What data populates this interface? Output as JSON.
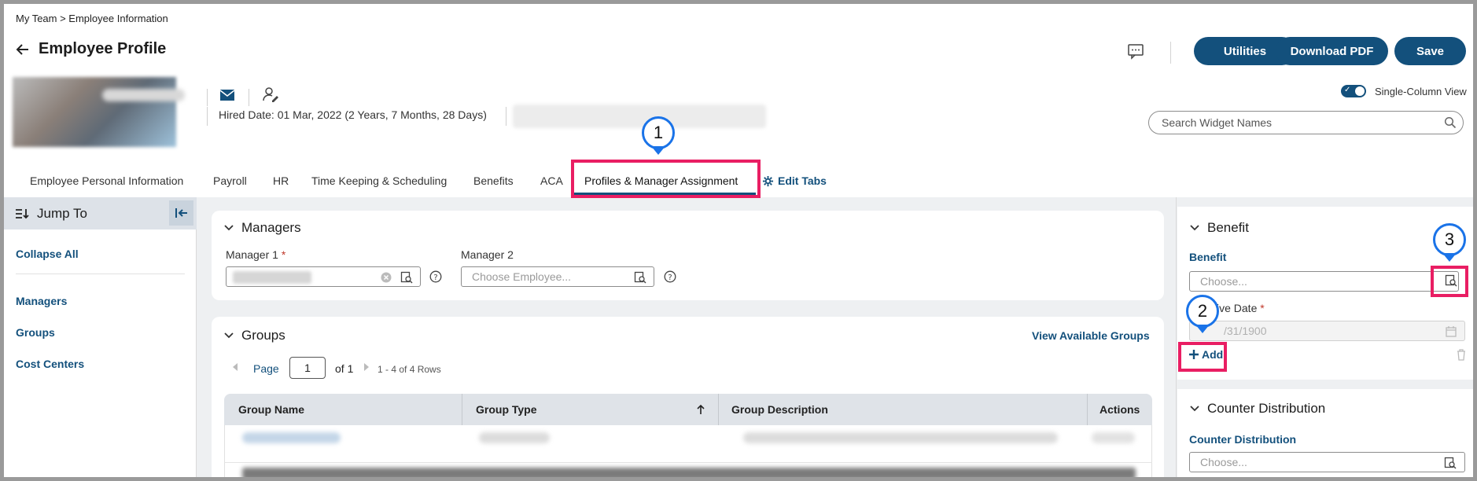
{
  "breadcrumb": "My Team  >  Employee Information",
  "page_title": "Employee Profile",
  "buttons": {
    "utilities": "Utilities",
    "download_pdf": "Download PDF",
    "save": "Save"
  },
  "employee": {
    "hired_label": "Hired Date:",
    "hired_value": "01 Mar, 2022 (2 Years, 7 Months, 28 Days)"
  },
  "view_toggle": {
    "label": "Single-Column View",
    "on": true
  },
  "widget_search": {
    "placeholder": "Search Widget Names"
  },
  "tabs": [
    {
      "label": "Employee Personal Information"
    },
    {
      "label": "Payroll"
    },
    {
      "label": "HR"
    },
    {
      "label": "Time Keeping & Scheduling"
    },
    {
      "label": "Benefits"
    },
    {
      "label": "ACA"
    },
    {
      "label": "Profiles & Manager Assignment",
      "active": true
    }
  ],
  "edit_tabs": "Edit Tabs",
  "sidebar": {
    "title": "Jump To",
    "collapse_all": "Collapse All",
    "links": [
      "Managers",
      "Groups",
      "Cost Centers"
    ]
  },
  "managers": {
    "title": "Managers",
    "manager1_label": "Manager 1",
    "manager2_label": "Manager 2",
    "manager2_placeholder": "Choose Employee..."
  },
  "groups": {
    "title": "Groups",
    "view_link": "View Available Groups",
    "pager": {
      "page_label": "Page",
      "page": "1",
      "of": "of 1",
      "rows": "1 - 4 of 4 Rows"
    },
    "columns": [
      "Group Name",
      "Group Type",
      "Group Description",
      "Actions"
    ]
  },
  "benefit": {
    "title": "Benefit",
    "field_label": "Benefit",
    "placeholder": "Choose...",
    "date_label": "ive Date",
    "date_value": "/31/1900",
    "add": "Add"
  },
  "counter": {
    "title": "Counter Distribution",
    "field_label": "Counter Distribution",
    "placeholder": "Choose..."
  },
  "callouts": [
    "1",
    "2",
    "3"
  ],
  "colors": {
    "brand": "#13507c",
    "callout_box": "#e91e63",
    "callout_pin": "#1a73e8"
  }
}
